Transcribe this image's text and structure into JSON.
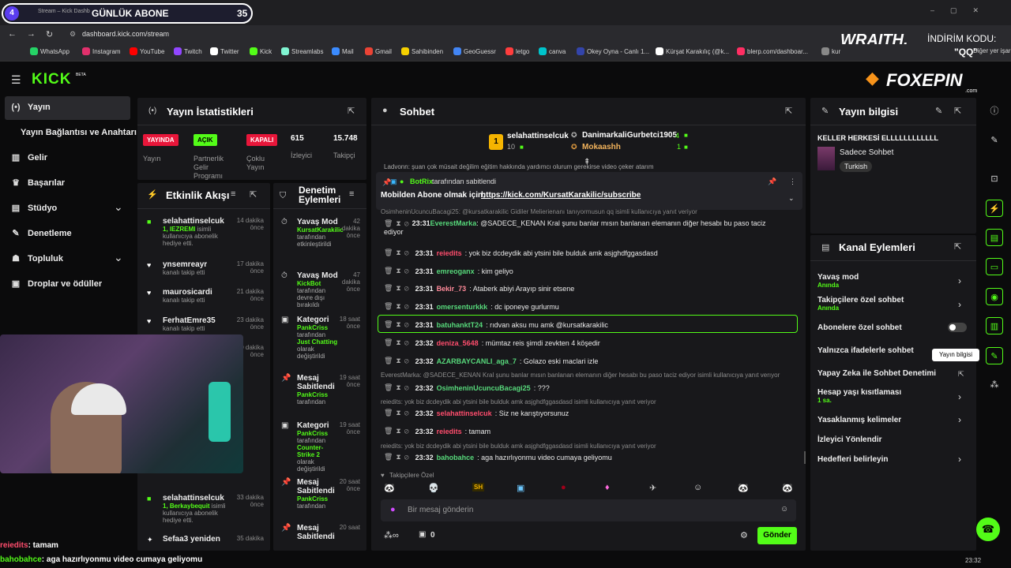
{
  "browser": {
    "tab_title": "Stream – Kick Dashb",
    "address": "dashboard.kick.com/stream",
    "bookmarks": [
      "WhatsApp",
      "Instagram",
      "YouTube",
      "Twitch",
      "Twitter",
      "Kick",
      "Streamlabs",
      "Mail",
      "Gmail",
      "Sahibinden",
      "GeoGuessr",
      "letgo",
      "canva",
      "Okey Oyna - Canlı 1...",
      "Kürşat Karakılıç (@k...",
      "blerp.com/dashboar...",
      "kur"
    ],
    "other_bookmarks": "Diğer yer işaretleri",
    "clock": "23:32"
  },
  "overlay": {
    "goal_number": "4",
    "goal_label": "GÜNLÜK ABONE",
    "goal_count": "35",
    "wraith": "WRAITH.",
    "discount_label": "İNDİRİM KODU:",
    "discount_code": "\"QQ\"",
    "sponsor": "FOXEPIN",
    "sponsor_sub": ".com",
    "ticker_user1": "reiedits",
    "ticker_text1": ": tamam",
    "ticker_user2": "bahobahce",
    "ticker_text2": ": aga hazırlıyonmu video cumaya geliyomu"
  },
  "sidebar": {
    "logo": "KICK",
    "logo_tag": "BETA",
    "items": [
      {
        "label": "Yayın",
        "icon": "broadcast-icon"
      },
      {
        "label": "Yayın Bağlantısı ve Anahtarı",
        "icon": ""
      },
      {
        "label": "Gelir",
        "icon": "chart-icon"
      },
      {
        "label": "Başarılar",
        "icon": "trophy-icon"
      },
      {
        "label": "Stüdyo",
        "icon": "studio-icon"
      },
      {
        "label": "Denetleme",
        "icon": "wrench-icon"
      },
      {
        "label": "Topluluk",
        "icon": "community-icon"
      },
      {
        "label": "Droplar ve ödüller",
        "icon": "drops-icon"
      }
    ]
  },
  "stats": {
    "title": "Yayın İstatistikleri",
    "live_badge": "YAYINDA",
    "live_label": "Yayın",
    "partner_badge": "AÇIK",
    "partner_label": "Partnerlik Gelir Programı",
    "multi_badge": "KAPALI",
    "multi_label": "Çoklu Yayın",
    "viewers": "615",
    "viewers_label": "İzleyici",
    "followers": "15.748",
    "followers_label": "Takipçi"
  },
  "activity": {
    "title": "Etkinlik Akışı",
    "items": [
      {
        "user": "selahattinselcuk",
        "desc_g": "1, IEZREMI",
        "desc": " isimli kullanıcıya abonelik hediye etti.",
        "when": "14 dakika önce"
      },
      {
        "user": "ynsemreayr",
        "desc_g": "",
        "desc": "kanalı takip etti",
        "when": "17 dakika önce"
      },
      {
        "user": "maurosicardi",
        "desc_g": "",
        "desc": "kanalı takip etti",
        "when": "21 dakika önce"
      },
      {
        "user": "FerhatEmre35",
        "desc_g": "",
        "desc": "kanalı takip etti",
        "when": "23 dakika önce"
      },
      {
        "user": "",
        "desc_g": "",
        "desc": "kanalı takip etti",
        "when": "30 dakika önce"
      },
      {
        "user": "selahattinselcuk",
        "desc_g": "1, Berkaybequit",
        "desc": " isimli kullanıcıya abonelik hediye etti.",
        "when": "33 dakika önce"
      },
      {
        "user": "Sefaa3 yeniden",
        "desc_g": "",
        "desc": "",
        "when": "35 dakika"
      }
    ]
  },
  "modlog": {
    "title": "Denetim Eylemleri",
    "items": [
      {
        "title": "Yavaş Mod",
        "who": "KursatKarakilic",
        "rest": "tarafından etkinleştirildi",
        "when": "42 dakika önce"
      },
      {
        "title": "Yavaş Mod",
        "who": "KickBot",
        "rest": "tarafından devre dışı bırakıldı",
        "when": "47 dakika önce"
      },
      {
        "title": "Kategori",
        "who": "PankCriss",
        "rest": "tarafından ",
        "extra_g": "Just Chatting",
        "rest2": " olarak değiştirildi",
        "when": "18 saat önce"
      },
      {
        "title": "Mesaj Sabitlendi",
        "who": "PankCriss",
        "rest": "tarafından",
        "when": "19 saat önce"
      },
      {
        "title": "Kategori",
        "who": "PankCriss",
        "rest": "tarafından ",
        "extra_g": "Counter-Strike 2",
        "rest2": " olarak değiştirildi",
        "when": "19 saat önce"
      },
      {
        "title": "Mesaj Sabitlendi",
        "who": "PankCriss",
        "rest": "tarafından",
        "when": "20 saat önce"
      },
      {
        "title": "Mesaj Sabitlendi",
        "who": "",
        "rest": "",
        "when": "20 saat"
      }
    ]
  },
  "chat": {
    "title": "Sohbet",
    "top1_name": "selahattinselcuk",
    "top1_count": "10",
    "top2_name": "DanimarkaliGurbetci1905",
    "top2_count": "4",
    "top3_name": "Mokaashh",
    "top3_count": "1",
    "partial_line": "Ladvonn: şuan çok müsait değilim eğitim hakkında yardımcı olurum gerekirse video çeker atarım",
    "pinned_by_user": "BotRix",
    "pinned_by_text": "tarafından sabitlendi",
    "pinned_msg": "Mobilden Abone olmak için; ",
    "pinned_link": "https://kick.com/KursatKarakilic/subscribe",
    "reply0": "OsimheninUcuncuBacagi25: @kursatkarakilic Gidiler Melierienanı tanıyormusun qq isimli kullanıcıya yanıt veriyor",
    "messages": [
      {
        "time": "23:31",
        "user": "EverestMarka",
        "color": "#57d97b",
        "text": ": @SADECE_KENAN Kral şunu banlar mısın banlanan elemanın diğer hesabı bu paso taciz ediyor"
      },
      {
        "time": "23:31",
        "user": "reiedits",
        "color": "#ff4d6d",
        "text": ": yok biz dcdeydik abi ytsini bile bulduk amk asjghdfggasdasd"
      },
      {
        "time": "23:31",
        "user": "emreoganx",
        "color": "#57d97b",
        "text": ": kim geliyo"
      },
      {
        "time": "23:31",
        "user": "Bekir_73",
        "color": "#ff8a9a",
        "text": ": Ataberk abiyi Arayıp sinir etsene"
      },
      {
        "time": "23:31",
        "user": "omersenturkkk",
        "color": "#57d97b",
        "text": ": dc iponeye gurlurmu"
      },
      {
        "time": "23:31",
        "user": "batuhanktT24",
        "color": "#57d97b",
        "text": ": rıdvan aksu mu amk @kursatkarakilic"
      },
      {
        "time": "23:32",
        "user": "deniza_5648",
        "color": "#ff4d6d",
        "text": ": mümtaz reis şimdi zevkten 4 köşedir"
      },
      {
        "time": "23:32",
        "user": "AZARBAYCANLI_aga_7",
        "color": "#57d97b",
        "text": ": Golazo eski maclari izle"
      },
      {
        "time": "23:32",
        "user": "OsimheninUcuncuBacagi25",
        "color": "#57d97b",
        "text": ": ???"
      },
      {
        "time": "23:32",
        "user": "selahattinselcuk",
        "color": "#ff4d6d",
        "text": ": Siz ne karıştıyorsunuz"
      },
      {
        "time": "23:32",
        "user": "reiedits",
        "color": "#ff4d6d",
        "text": ": tamam"
      },
      {
        "time": "23:32",
        "user": "bahobahce",
        "color": "#57d97b",
        "text": ": aga hazırlıyonmu video cumaya geliyomu"
      }
    ],
    "reply1": "EverestMarka: @SADECE_KENAN Kral şunu banlar mısın banlanan elemanın diğer hesabı bu paso taciz ediyor isimli kullanıcıya yanıt verıyor",
    "reply2": "reiedits: yok biz dcdeydik abi ytsini bile bulduk amk asjghdfggasdasd isimli kullanıcıya yanıt veriyor",
    "reply3": "reiedits: yok biz dcdeydik abi ytsini bile bulduk amk asjghdfggasdasd isimli kullanıcıya yanıt veriyor",
    "followers_only": "Takipçilere Özel",
    "emotes": [
      "SH"
    ],
    "input_placeholder": "Bir mesaj gönderin",
    "points": "0",
    "send": "Gönder"
  },
  "info": {
    "title": "Yayın bilgisi",
    "stream_title": "KELLER HERKESİ ELLLLLLLLLLLL",
    "category": "Sadece Sohbet",
    "language": "Turkish"
  },
  "actions": {
    "title": "Kanal Eylemleri",
    "slow": "Yavaş mod",
    "slow_sub": "Anında",
    "follow": "Takipçilere özel sohbet",
    "follow_sub": "Anında",
    "subs": "Abonelere özel sohbet",
    "emotes": "Yalnızca ifadelerle sohbet",
    "ai": "Yapay Zeka ile Sohbet Denetimi",
    "age": "Hesap yaşı kısıtlaması",
    "age_sub": "1 sa.",
    "banned": "Yasaklanmış kelimeler",
    "redirect": "İzleyici Yönlendir",
    "goals": "Hedefleri belirleyin",
    "tooltip": "Yayın bilgisi"
  },
  "colors": {
    "accent": "#53fc18",
    "panel": "#18181b",
    "bg": "#0b0b0c",
    "live": "#e8163a"
  }
}
